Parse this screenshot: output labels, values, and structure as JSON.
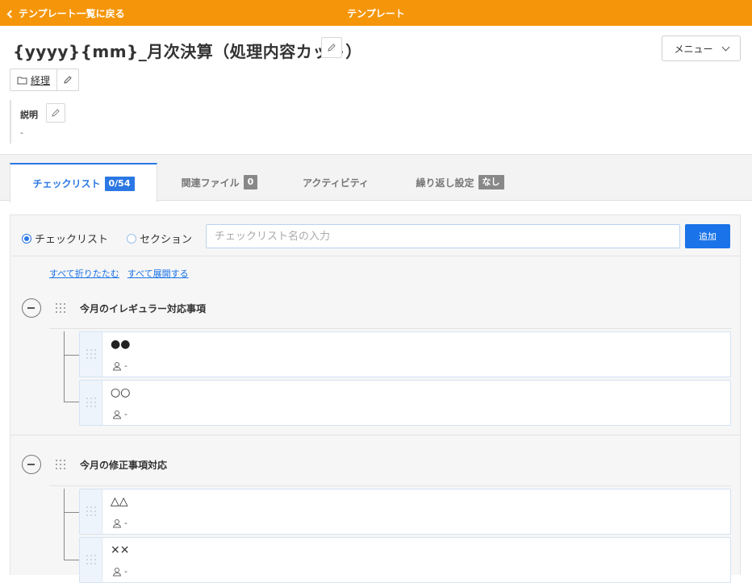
{
  "topbar": {
    "back_label": "テンプレート一覧に戻る",
    "page_title": "テンプレート"
  },
  "template": {
    "title": "{yyyy}{mm}_月次決算（処理内容カット）",
    "folder": "経理",
    "description_label": "説明",
    "description_value": "-"
  },
  "menu": {
    "label": "メニュー"
  },
  "tabs": [
    {
      "label": "チェックリスト",
      "badge": "0/54",
      "active": true
    },
    {
      "label": "関連ファイル",
      "badge": "0",
      "active": false
    },
    {
      "label": "アクティビティ",
      "badge": "",
      "active": false
    },
    {
      "label": "繰り返し設定",
      "badge": "なし",
      "active": false
    }
  ],
  "add_form": {
    "radio_checklist": "チェックリスト",
    "radio_section": "セクション",
    "selected": "チェックリスト",
    "input_placeholder": "チェックリスト名の入力",
    "input_value": "",
    "add_label": "追加"
  },
  "links": {
    "collapse_all": "すべて折りたたむ",
    "expand_all": "すべて展開する"
  },
  "sections": [
    {
      "title": "今月のイレギュラー対応事項",
      "items": [
        {
          "name": "●●",
          "assignee": "-"
        },
        {
          "name": "○○",
          "assignee": "-"
        }
      ]
    },
    {
      "title": "今月の修正事項対応",
      "items": [
        {
          "name": "△△",
          "assignee": "-"
        },
        {
          "name": "××",
          "assignee": "-"
        }
      ]
    }
  ],
  "colors": {
    "topbar": "#f5960a",
    "accent": "#2b78e4",
    "button": "#1a73e8"
  }
}
